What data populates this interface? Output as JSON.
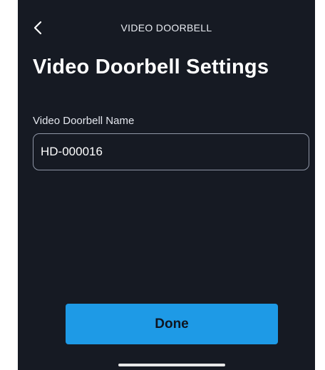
{
  "header": {
    "title": "VIDEO DOORBELL",
    "back_icon": "chevron-left-icon"
  },
  "page": {
    "title": "Video Doorbell Settings"
  },
  "form": {
    "name_label": "Video Doorbell Name",
    "name_value": "HD-000016"
  },
  "actions": {
    "done_label": "Done"
  },
  "colors": {
    "background": "#161a23",
    "accent": "#1e9ae6",
    "input_border": "#8f96a6"
  }
}
